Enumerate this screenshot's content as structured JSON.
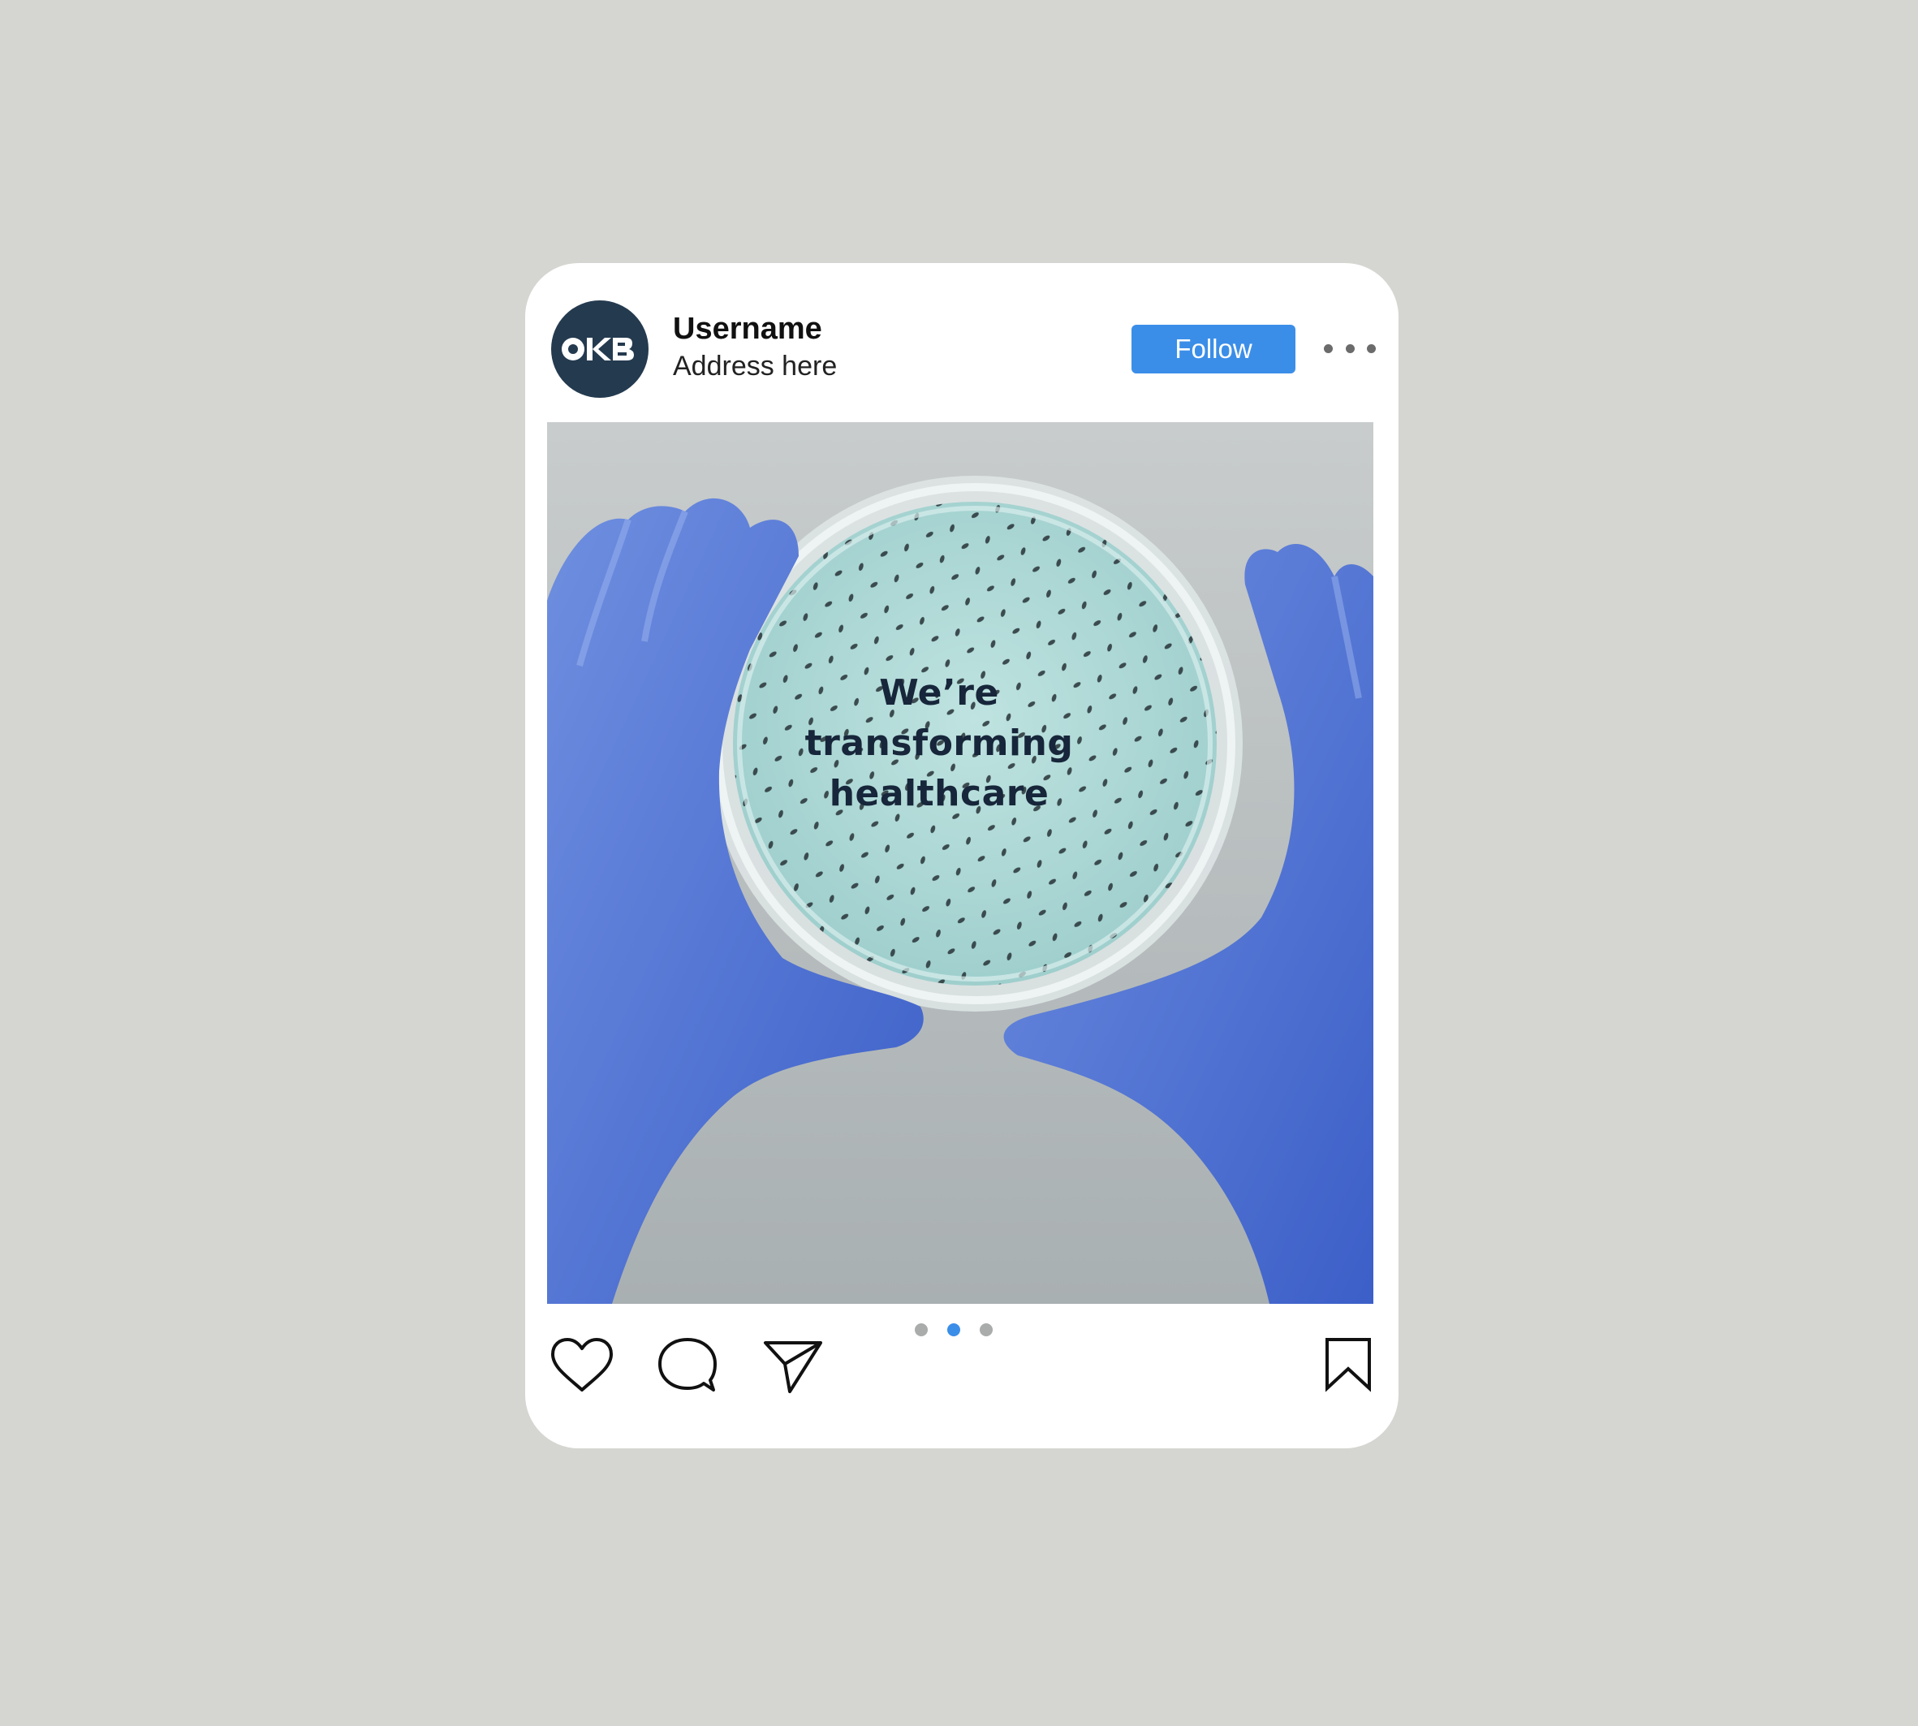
{
  "post": {
    "avatar_logo_text": "OKB",
    "username": "Username",
    "address": "Address here",
    "follow_label": "Follow",
    "image_caption_lines": [
      "We’re",
      "transforming",
      "healthcare"
    ],
    "carousel": {
      "total": 3,
      "active": 2
    }
  },
  "icons": {
    "more": "more-horizontal-icon",
    "like": "heart-icon",
    "comment": "speech-bubble-icon",
    "share": "paper-plane-icon",
    "save": "bookmark-icon"
  },
  "colors": {
    "background": "#d5d6d1",
    "card": "#ffffff",
    "accent": "#3b8ee8",
    "avatar": "#243a4f",
    "dot_inactive": "#a9acaa",
    "caption_text": "#17263a"
  }
}
